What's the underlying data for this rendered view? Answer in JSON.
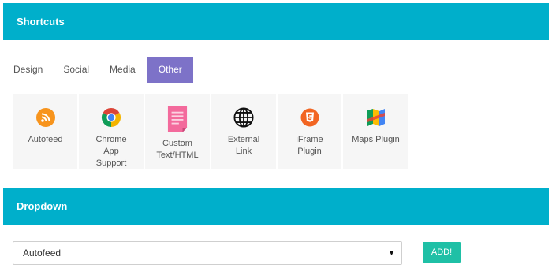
{
  "shortcuts": {
    "title": "Shortcuts"
  },
  "tabs": [
    {
      "label": "Design"
    },
    {
      "label": "Social"
    },
    {
      "label": "Media"
    },
    {
      "label": "Other",
      "active": true
    }
  ],
  "tiles": [
    {
      "label": "Autofeed",
      "icon": "rss-icon"
    },
    {
      "label": "Chrome\nApp\nSupport",
      "icon": "chrome-icon"
    },
    {
      "label": "Custom\nText/HTML",
      "icon": "document-icon"
    },
    {
      "label": "External\nLink",
      "icon": "globe-icon"
    },
    {
      "label": "iFrame\nPlugin",
      "icon": "html5-icon"
    },
    {
      "label": "Maps Plugin",
      "icon": "map-icon"
    }
  ],
  "dropdown": {
    "title": "Dropdown",
    "selected": "Autofeed",
    "add_label": "ADD!"
  },
  "colors": {
    "header": "#00afcb",
    "active_tab": "#7d72c8",
    "add_button": "#1fc0a6"
  }
}
